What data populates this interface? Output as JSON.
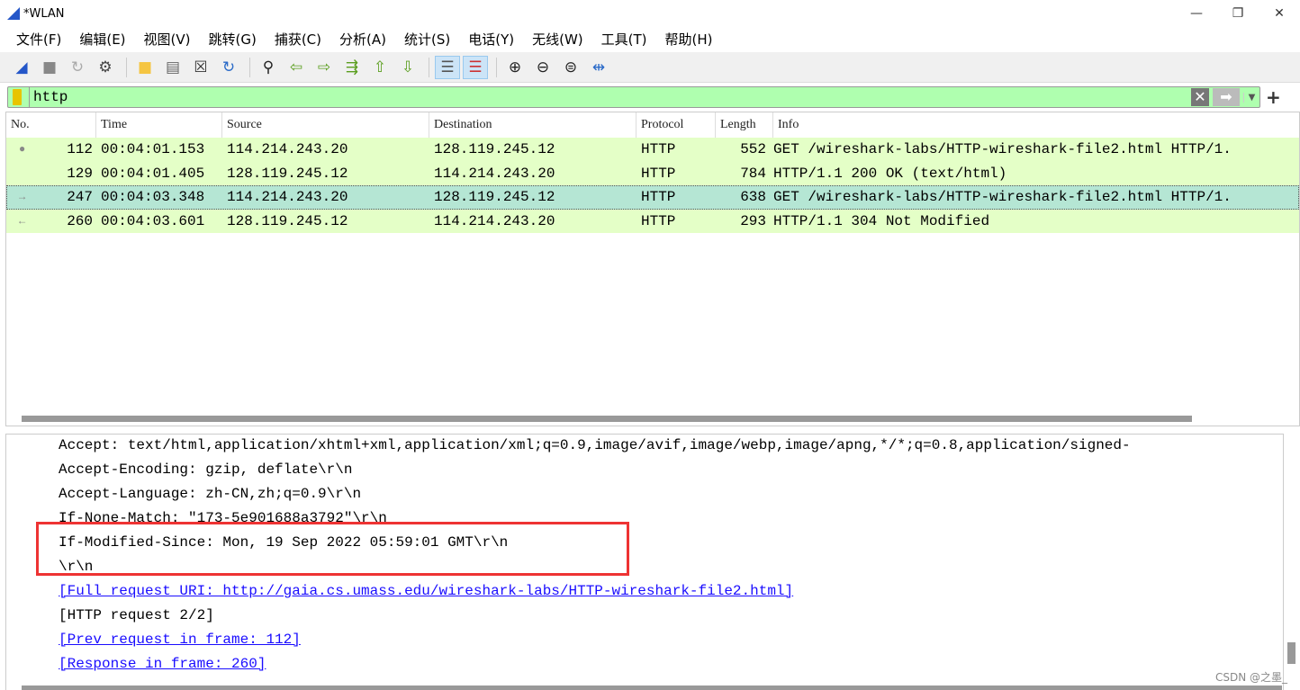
{
  "window": {
    "title": "*WLAN",
    "controls": [
      "—",
      "❐",
      "✕"
    ]
  },
  "menu": [
    "文件(F)",
    "编辑(E)",
    "视图(V)",
    "跳转(G)",
    "捕获(C)",
    "分析(A)",
    "统计(S)",
    "电话(Y)",
    "无线(W)",
    "工具(T)",
    "帮助(H)"
  ],
  "toolbar": {
    "icons": [
      "start-capture",
      "stop-capture",
      "restart-capture",
      "capture-options",
      "open-file",
      "save-file",
      "close-file",
      "reload-file",
      "find-packet",
      "go-back",
      "go-forward",
      "go-to-packet",
      "go-first",
      "go-last",
      "auto-scroll",
      "colorize",
      "zoom-in",
      "zoom-out",
      "zoom-normal",
      "resize-columns"
    ]
  },
  "filter": {
    "value": "http"
  },
  "packet_list": {
    "columns": [
      "No.",
      "Time",
      "Source",
      "Destination",
      "Protocol",
      "Length",
      "Info"
    ],
    "rows": [
      {
        "no": "112",
        "time": "00:04:01.153",
        "src": "114.214.243.20",
        "dst": "128.119.245.12",
        "proto": "HTTP",
        "len": "552",
        "info": "GET /wireshark-labs/HTTP-wireshark-file2.html HTTP/1."
      },
      {
        "no": "129",
        "time": "00:04:01.405",
        "src": "128.119.245.12",
        "dst": "114.214.243.20",
        "proto": "HTTP",
        "len": "784",
        "info": "HTTP/1.1 200 OK  (text/html)"
      },
      {
        "no": "247",
        "time": "00:04:03.348",
        "src": "114.214.243.20",
        "dst": "128.119.245.12",
        "proto": "HTTP",
        "len": "638",
        "info": "GET /wireshark-labs/HTTP-wireshark-file2.html HTTP/1."
      },
      {
        "no": "260",
        "time": "00:04:03.601",
        "src": "128.119.245.12",
        "dst": "114.214.243.20",
        "proto": "HTTP",
        "len": "293",
        "info": "HTTP/1.1 304 Not Modified"
      }
    ],
    "selected_row": "247"
  },
  "details": [
    {
      "text": "Accept: text/html,application/xhtml+xml,application/xml;q=0.9,image/avif,image/webp,image/apng,*/*;q=0.8,application/signed-",
      "link": false
    },
    {
      "text": "Accept-Encoding: gzip, deflate\\r\\n",
      "link": false
    },
    {
      "text": "Accept-Language: zh-CN,zh;q=0.9\\r\\n",
      "link": false
    },
    {
      "text": "If-None-Match: \"173-5e901688a3792\"\\r\\n",
      "link": false
    },
    {
      "text": "If-Modified-Since: Mon, 19 Sep 2022 05:59:01 GMT\\r\\n",
      "link": false
    },
    {
      "text": "\\r\\n",
      "link": false
    },
    {
      "text": "[Full request URI: http://gaia.cs.umass.edu/wireshark-labs/HTTP-wireshark-file2.html]",
      "link": true
    },
    {
      "text": "[HTTP request 2/2]",
      "link": false
    },
    {
      "text": "[Prev request in frame: 112]",
      "link": true
    },
    {
      "text": "[Response in frame: 260]",
      "link": true
    }
  ],
  "watermark": "CSDN @之墨_",
  "colors": {
    "row_bg": "#e4ffc7",
    "selected_bg": "#b5e6d4",
    "filter_bg": "#afffaf",
    "highlight_box": "#ee3333",
    "link": "#1a0dff"
  }
}
